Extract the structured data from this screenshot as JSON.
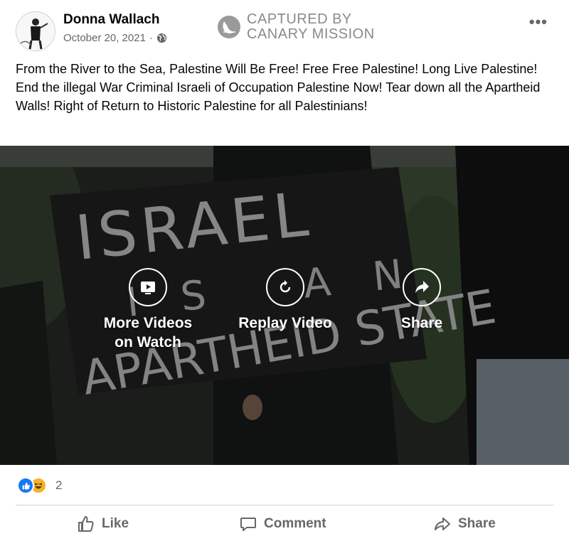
{
  "post": {
    "author": "Donna Wallach",
    "date": "October 20, 2021",
    "date_separator": "·",
    "privacy_icon": "globe-icon",
    "more_label": "•••",
    "text": "From the River to the Sea, Palestine Will Be Free! Free Free Palestine! Long Live Palestine! End the illegal War Criminal Israeli of Occupation Palestine Now! Tear down all the Apartheid Walls! Right of Return to Historic Palestine for all Palestinians!"
  },
  "watermark": {
    "line1": "CAPTURED BY",
    "line2": "CANARY MISSION"
  },
  "video": {
    "sign_text_line1": "ISRAEL",
    "sign_text_line2": "IS AN",
    "sign_text_line3": "APARTHEID STATE",
    "buttons": [
      {
        "label": "More Videos on Watch",
        "icon": "video-play-icon"
      },
      {
        "label": "Replay Video",
        "icon": "replay-icon"
      },
      {
        "label": "Share",
        "icon": "share-arrow-icon"
      }
    ]
  },
  "reactions": {
    "count": "2",
    "types": [
      "like",
      "haha"
    ]
  },
  "actions": {
    "like": "Like",
    "comment": "Comment",
    "share": "Share"
  },
  "colors": {
    "facebook_blue": "#1877f2",
    "haha_yellow": "#f7b125",
    "secondary_text": "#65676b",
    "watermark_gray": "#8a8a8a"
  }
}
